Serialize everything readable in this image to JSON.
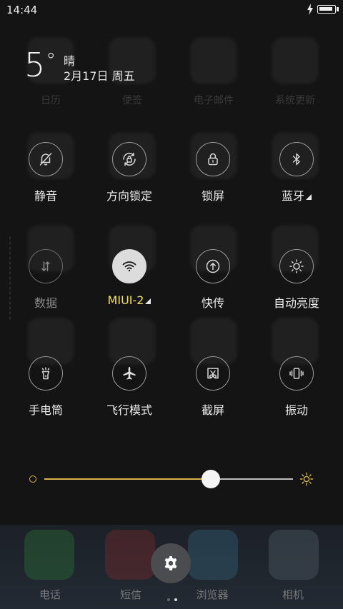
{
  "status_bar": {
    "time": "14:44",
    "battery_level": 0.95,
    "charging": true
  },
  "weather": {
    "temperature": "5",
    "degree_symbol": "°",
    "condition": "晴",
    "date": "2月17日 周五"
  },
  "background": {
    "app_labels_row1": [
      "日历",
      "便签",
      "电子邮件",
      "系统更新"
    ],
    "dock_labels": [
      "电话",
      "短信",
      "浏览器",
      "相机"
    ]
  },
  "toggles": [
    {
      "id": "silent",
      "label": "静音",
      "icon": "bell-off-icon",
      "active": false
    },
    {
      "id": "rotation-lock",
      "label": "方向锁定",
      "icon": "rotation-lock-icon",
      "active": false
    },
    {
      "id": "lock-screen",
      "label": "锁屏",
      "icon": "lock-icon",
      "active": false
    },
    {
      "id": "bluetooth",
      "label": "蓝牙",
      "icon": "bluetooth-icon",
      "active": false,
      "has_more": true
    },
    {
      "id": "data",
      "label": "数据",
      "icon": "data-arrows-icon",
      "active": false,
      "disabled": true
    },
    {
      "id": "wifi",
      "label": "MIUI-2",
      "icon": "wifi-icon",
      "active": true,
      "has_more": true
    },
    {
      "id": "quick-transfer",
      "label": "快传",
      "icon": "upload-icon",
      "active": false
    },
    {
      "id": "auto-brightness",
      "label": "自动亮度",
      "icon": "sun-icon",
      "active": false
    },
    {
      "id": "flashlight",
      "label": "手电筒",
      "icon": "flashlight-icon",
      "active": false
    },
    {
      "id": "airplane",
      "label": "飞行模式",
      "icon": "airplane-icon",
      "active": false
    },
    {
      "id": "screenshot",
      "label": "截屏",
      "icon": "screenshot-scissors-icon",
      "active": false
    },
    {
      "id": "vibrate",
      "label": "振动",
      "icon": "vibrate-icon",
      "active": false
    }
  ],
  "brightness": {
    "level": 0.67,
    "min_icon": "brightness-low-icon",
    "max_icon": "brightness-high-icon"
  },
  "settings": {
    "icon": "gear-icon"
  },
  "pager": {
    "count": 2,
    "current": 1
  },
  "colors": {
    "accent": "#f4e06a",
    "slider_fill": "#d8b24a",
    "active_toggle": "#dcdcdc",
    "settings_button": "#4a4c50"
  }
}
